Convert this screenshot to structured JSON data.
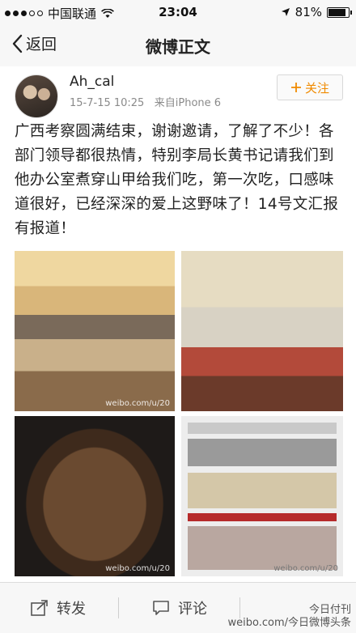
{
  "status_bar": {
    "carrier": "中国联通",
    "time": "23:04",
    "battery": "81%"
  },
  "nav": {
    "back_label": "返回",
    "title": "微博正文"
  },
  "post": {
    "username": "Ah_cal",
    "timestamp": "15-7-15 10:25",
    "source": "来自iPhone 6",
    "follow_label": "关注",
    "text": "广西考察圆满结束，谢谢邀请，了解了不少！各部门领导都很热情，特别李局长黄书记请我们到他办公室煮穿山甲给我们吃，第一次吃，口感味道很好，已经深深的爱上这野味了！14号文汇报有报道！",
    "photo_watermarks": [
      "weibo.com/u/20",
      "weibo.com/u/20",
      "weibo.com/u/20"
    ]
  },
  "toolbar": {
    "repost_label": "转发",
    "comment_label": "评论"
  },
  "watermark": {
    "line1": "今日付刊",
    "line2": "weibo.com/今日微博头条"
  },
  "colors": {
    "accent": "#f08a00",
    "background": "#f2f2f2"
  }
}
